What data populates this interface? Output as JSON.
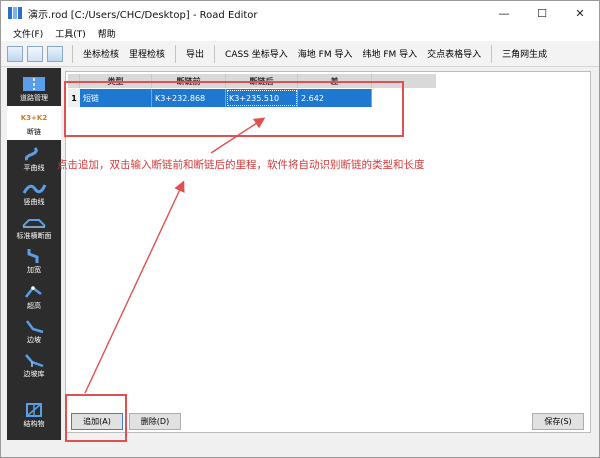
{
  "window": {
    "title": "演示.rod [C:/Users/CHC/Desktop] - Road Editor",
    "minimize": "—",
    "maximize": "☐",
    "close": "✕"
  },
  "menu": [
    "文件(F)",
    "工具(T)",
    "帮助"
  ],
  "toolbar": {
    "buttons": [
      "坐标检核",
      "里程检核",
      "导出",
      "CASS 坐标导入",
      "海地 FM 导入",
      "纬地 FM 导入",
      "交点表格导入",
      "三角网生成"
    ]
  },
  "sidebar": {
    "items": [
      {
        "label": "道路管理",
        "icon": "road-icon"
      },
      {
        "label": "断链",
        "icon": "chain-break-icon",
        "code": "K3+K2"
      },
      {
        "label": "平曲线",
        "icon": "horizontal-curve-icon"
      },
      {
        "label": "竖曲线",
        "icon": "vertical-curve-icon"
      },
      {
        "label": "标准横断面",
        "icon": "cross-section-icon"
      },
      {
        "label": "加宽",
        "icon": "widening-icon"
      },
      {
        "label": "超高",
        "icon": "superelevation-icon"
      },
      {
        "label": "边坡",
        "icon": "slope-icon"
      },
      {
        "label": "边坡库",
        "icon": "slope-library-icon"
      },
      {
        "label": "结构物",
        "icon": "structure-icon"
      }
    ]
  },
  "table": {
    "columns": [
      "类型",
      "断链前",
      "断链后",
      "差"
    ],
    "rows": [
      {
        "num": "1",
        "type": "短链",
        "before": "K3+232.868",
        "after": "K3+235.510",
        "diff": "2.642"
      }
    ]
  },
  "annotation": "点击追加，双击输入断链前和断链后的里程，软件将自动识别断链的类型和长度",
  "buttons": {
    "add": "追加(A)",
    "delete": "删除(D)",
    "save": "保存(S)"
  },
  "colors": {
    "selection": "#1e78d2",
    "annotation": "#d23a3a",
    "sidebar_bg": "#2c2c2c"
  }
}
